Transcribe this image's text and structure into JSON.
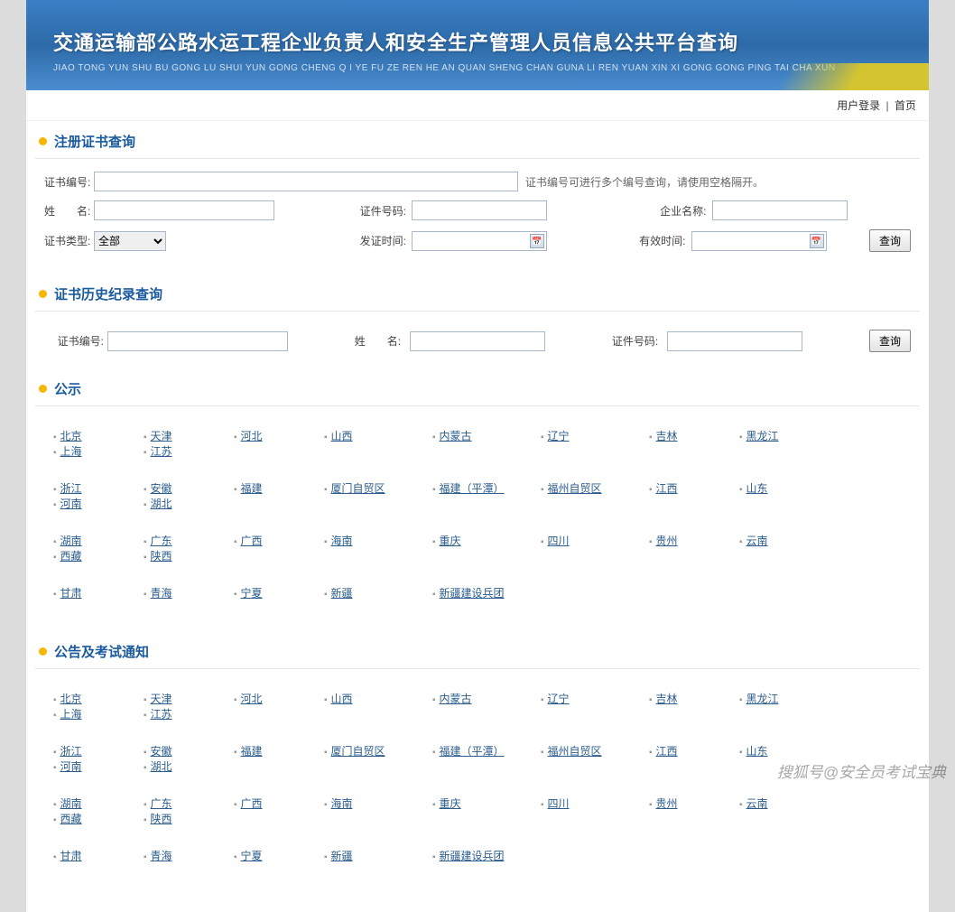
{
  "banner": {
    "title": "交通运输部公路水运工程企业负责人和安全生产管理人员信息公共平台查询",
    "subtitle": "JIAO TONG YUN SHU BU GONG LU SHUI YUN GONG CHENG Q I YE FU ZE REN HE AN QUAN SHENG CHAN GUNA LI REN YUAN XIN XI GONG GONG PING TAI CHA XUN"
  },
  "topbar": {
    "login": "用户登录",
    "home": "首页",
    "sep": "|"
  },
  "sections": {
    "cert_query": "注册证书查询",
    "history_query": "证书历史纪录查询",
    "announcement": "公示",
    "exam_notice": "公告及考试通知"
  },
  "form": {
    "cert_no_label": "证书编号:",
    "cert_no_hint": "证书编号可进行多个编号查询，请使用空格隔开。",
    "name_label": "姓　　名:",
    "id_no_label": "证件号码:",
    "company_label": "企业名称:",
    "cert_type_label": "证书类型:",
    "cert_type_value": "全部",
    "issue_date_label": "发证时间:",
    "valid_date_label": "有效时间:",
    "search_btn": "查询"
  },
  "history_form": {
    "cert_no_label": "证书编号:",
    "name_label": "姓　　名:",
    "id_no_label": "证件号码:",
    "search_btn": "查询"
  },
  "provinces_row1": [
    "北京",
    "天津",
    "河北",
    "山西",
    "内蒙古",
    "辽宁",
    "吉林",
    "黑龙江",
    "上海",
    "江苏"
  ],
  "provinces_row2": [
    "浙江",
    "安徽",
    "福建",
    "厦门自贸区",
    "福建（平潭）",
    "福州自贸区",
    "江西",
    "山东",
    "河南",
    "湖北"
  ],
  "provinces_row3": [
    "湖南",
    "广东",
    "广西",
    "海南",
    "重庆",
    "四川",
    "贵州",
    "云南",
    "西藏",
    "陕西"
  ],
  "provinces_row4": [
    "甘肃",
    "青海",
    "宁夏",
    "新疆",
    "新疆建设兵团"
  ],
  "watermark": "搜狐号@安全员考试宝典"
}
